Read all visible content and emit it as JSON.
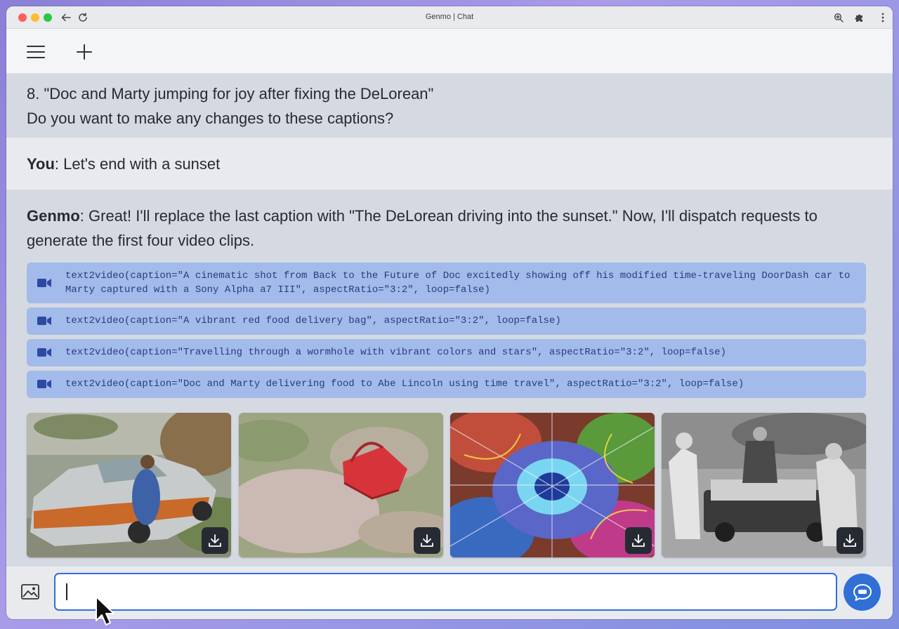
{
  "browser": {
    "title": "Genmo | Chat"
  },
  "app": {
    "menu_icon": "menu-icon",
    "new_icon": "plus-icon"
  },
  "messages": {
    "prev": {
      "line1": "8. \"Doc and Marty jumping for joy after fixing the DeLorean\"",
      "line2": "Do you want to make any changes to these captions?"
    },
    "you": {
      "speaker": "You",
      "text": ": Let's end with a sunset"
    },
    "genmo": {
      "speaker": "Genmo",
      "text": ": Great! I'll replace the last caption with \"The DeLorean driving into the sunset.\" Now, I'll dispatch requests to generate the first four video clips."
    },
    "tool_calls": [
      "text2video(caption=\"A cinematic shot from Back to the Future of Doc excitedly showing off his modified time-traveling DoorDash car to Marty captured with a Sony Alpha a7 III\", aspectRatio=\"3:2\", loop=false)",
      "text2video(caption=\"A vibrant red food delivery bag\", aspectRatio=\"3:2\", loop=false)",
      "text2video(caption=\"Travelling through a wormhole with vibrant colors and stars\", aspectRatio=\"3:2\", loop=false)",
      "text2video(caption=\"Doc and Marty delivering food to Abe Lincoln using time travel\", aspectRatio=\"3:2\", loop=false)"
    ]
  },
  "composer": {
    "value": "",
    "placeholder": ""
  },
  "colors": {
    "accent": "#2f6fd6",
    "tool_bg": "#a3bbea",
    "tool_text": "#273b7f"
  }
}
